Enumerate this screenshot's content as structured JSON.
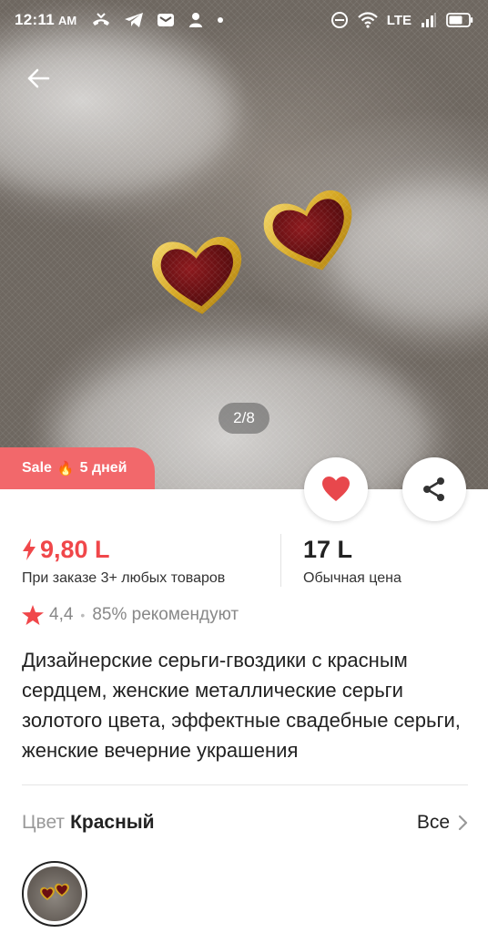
{
  "status_bar": {
    "time": "12:11",
    "ampm": "AM",
    "network": "LTE",
    "icons_left": [
      "missed-call-icon",
      "telegram-icon",
      "mail-icon",
      "person-icon",
      "dot-icon"
    ],
    "icons_right": [
      "dnd-icon",
      "wifi-icon",
      "signal-icon",
      "battery-icon"
    ]
  },
  "gallery": {
    "counter": "2/8",
    "current": 2,
    "total": 8
  },
  "sale_badge": {
    "text": "Sale",
    "emoji": "🔥",
    "days": "5 дней"
  },
  "price": {
    "promo": "9,80 L",
    "promo_caption": "При заказе 3+ любых товаров",
    "regular": "17 L",
    "regular_caption": "Обычная цена"
  },
  "rating": {
    "value": "4,4",
    "recommend": "85% рекомендуют"
  },
  "product_title": "Дизайнерские серьги-гвоздики с красным сердцем, женские металлические серьги золотого цвета, эффектные свадебные серьги, женские вечерние украшения",
  "color": {
    "label": "Цвет",
    "value": "Красный",
    "all_label": "Все"
  },
  "colors": {
    "accent": "#f0474a",
    "sale_badge": "#f2686b",
    "heart_red": "#e8474c"
  }
}
